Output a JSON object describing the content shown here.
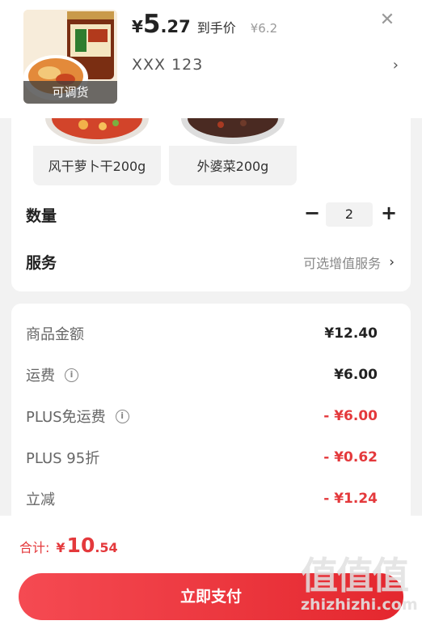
{
  "header": {
    "thumb_badge": "可调货",
    "price_currency": "¥",
    "price_int": "5",
    "price_dec": ".27",
    "price_tag": "到手价",
    "price_original": "¥6.2",
    "variant": "XXX  123",
    "close_icon": "close-icon",
    "chevron": "›"
  },
  "options": [
    {
      "label": "风干萝卜干200g"
    },
    {
      "label": "外婆菜200g"
    }
  ],
  "quantity": {
    "label": "数量",
    "value": "2",
    "minus": "−",
    "plus": "+"
  },
  "service": {
    "label": "服务",
    "hint": "可选增值服务",
    "chevron": "›"
  },
  "amounts": [
    {
      "label": "商品金额",
      "value": "¥12.40",
      "info": false,
      "negative": false
    },
    {
      "label": "运费",
      "value": "¥6.00",
      "info": true,
      "negative": false
    },
    {
      "label": "PLUS免运费",
      "value": "- ¥6.00",
      "info": true,
      "negative": true
    },
    {
      "label": "PLUS 95折",
      "value": "- ¥0.62",
      "info": false,
      "negative": true
    },
    {
      "label": "立减",
      "value": "- ¥1.24",
      "info": false,
      "negative": true
    }
  ],
  "total": {
    "label": "合计:",
    "currency": "¥",
    "int": "10",
    "dec": ".54"
  },
  "pay_button": "立即支付",
  "watermark": {
    "logo": "值值值",
    "text": "zhizhizhi.com"
  },
  "colors": {
    "accent": "#e4393c",
    "background": "#f2f2f2"
  }
}
